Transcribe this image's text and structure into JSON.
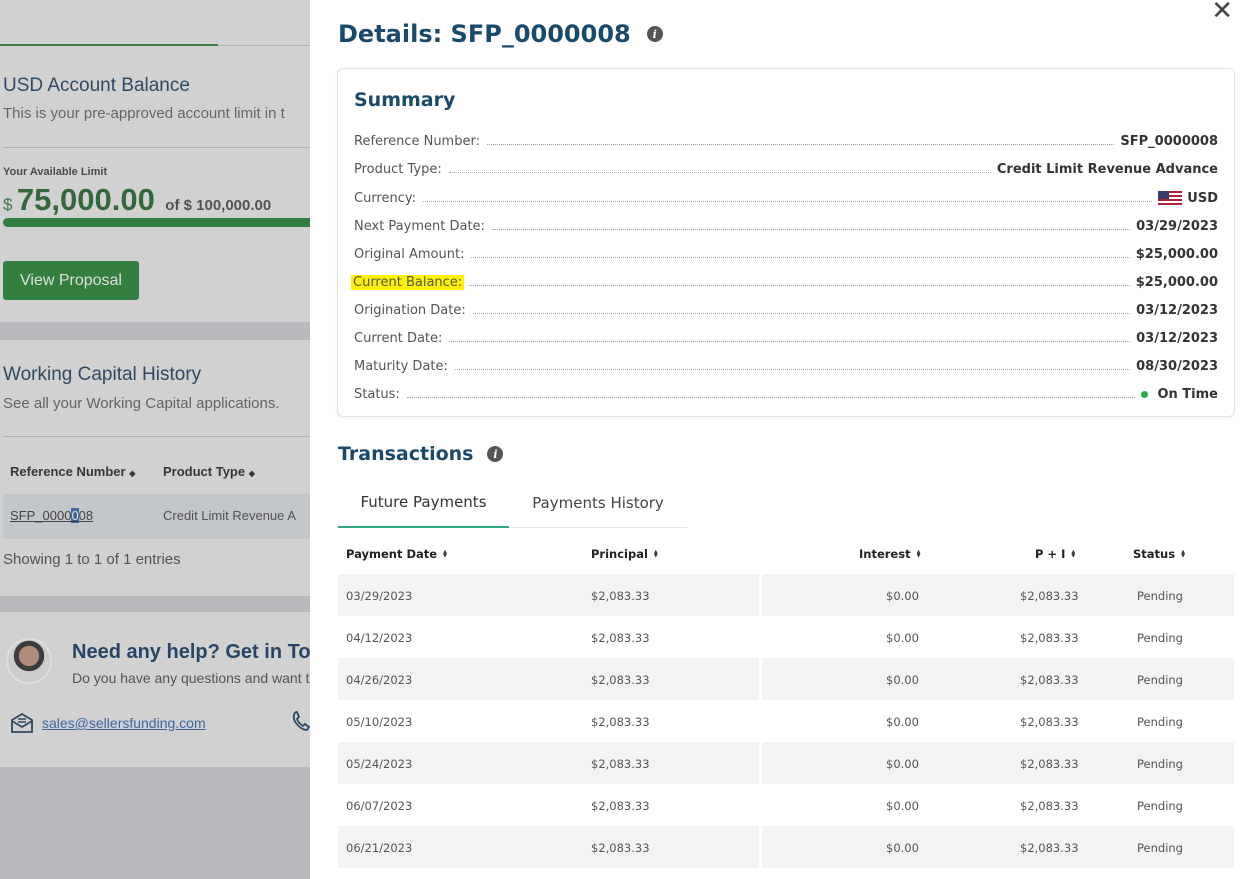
{
  "background": {
    "account_title": "USD Account Balance",
    "account_subtitle": "This is your pre-approved account limit in t",
    "available_label": "Your Available Limit",
    "currency_symbol": "$",
    "available_amount": "75,000.00",
    "limit_text": "of $ 100,000.00",
    "view_proposal_label": "View Proposal",
    "history_title": "Working Capital History",
    "history_subtitle": "See all your Working Capital applications.",
    "col_reference": "Reference Number",
    "col_product": "Product Type",
    "row_ref_before": "SFP_0000",
    "row_ref_selected": "0",
    "row_ref_after": "08",
    "row_product": "Credit Limit Revenue A",
    "showing": "Showing 1 to 1 of 1 entries",
    "help_title": "Need any help? Get in Tou",
    "help_subtitle": "Do you have any questions and want t",
    "email": "sales@sellersfunding.com"
  },
  "drawer": {
    "close_glyph": "✕",
    "title": "Details: SFP_0000008",
    "info_glyph": "i",
    "summary_title": "Summary",
    "summary": [
      {
        "label": "Reference Number:",
        "value": "SFP_0000008"
      },
      {
        "label": "Product Type:",
        "value": "Credit Limit Revenue Advance"
      },
      {
        "label": "Currency:",
        "value": "USD"
      },
      {
        "label": "Next Payment Date:",
        "value": "03/29/2023"
      },
      {
        "label": "Original Amount:",
        "value": "$25,000.00"
      },
      {
        "label": "Current Balance:",
        "value": "$25,000.00"
      },
      {
        "label": "Origination Date:",
        "value": "03/12/2023"
      },
      {
        "label": "Current Date:",
        "value": "03/12/2023"
      },
      {
        "label": "Maturity Date:",
        "value": "08/30/2023"
      },
      {
        "label": "Status:",
        "value": "On Time"
      }
    ],
    "transactions_title": "Transactions",
    "tabs": [
      "Future Payments",
      "Payments History"
    ],
    "columns": [
      "Payment Date",
      "Principal",
      "Interest",
      "P + I",
      "Status"
    ],
    "rows": [
      [
        "03/29/2023",
        "$2,083.33",
        "$0.00",
        "$2,083.33",
        "Pending"
      ],
      [
        "04/12/2023",
        "$2,083.33",
        "$0.00",
        "$2,083.33",
        "Pending"
      ],
      [
        "04/26/2023",
        "$2,083.33",
        "$0.00",
        "$2,083.33",
        "Pending"
      ],
      [
        "05/10/2023",
        "$2,083.33",
        "$0.00",
        "$2,083.33",
        "Pending"
      ],
      [
        "05/24/2023",
        "$2,083.33",
        "$0.00",
        "$2,083.33",
        "Pending"
      ],
      [
        "06/07/2023",
        "$2,083.33",
        "$0.00",
        "$2,083.33",
        "Pending"
      ],
      [
        "06/21/2023",
        "$2,083.33",
        "$0.00",
        "$2,083.33",
        "Pending"
      ]
    ]
  },
  "colors": {
    "heading": "#1a4a6b",
    "accent_green": "#2e8b3e",
    "tab_underline": "#2bab7a",
    "highlight": "#fff200",
    "status_on_time": "#2eaa4a"
  }
}
